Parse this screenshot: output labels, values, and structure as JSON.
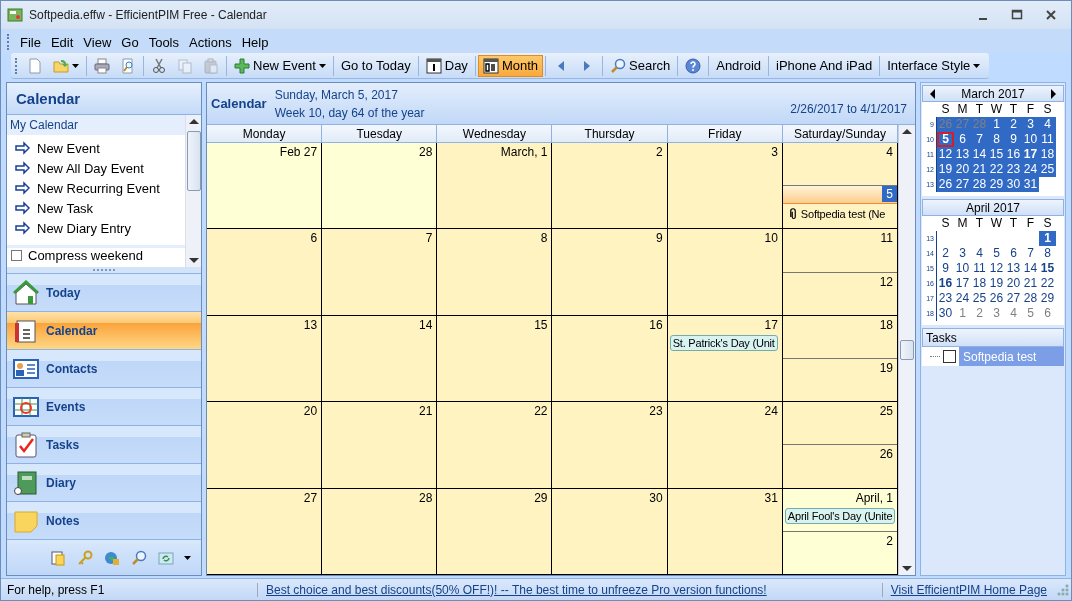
{
  "window": {
    "title": "Softpedia.effw - EfficientPIM Free - Calendar"
  },
  "menu": [
    "File",
    "Edit",
    "View",
    "Go",
    "Tools",
    "Actions",
    "Help"
  ],
  "toolbar": [
    {
      "kind": "icon",
      "disabled": false
    },
    {
      "kind": "icon",
      "disabled": false,
      "dropdown": true
    },
    {
      "kind": "separator"
    },
    {
      "kind": "icon",
      "disabled": false
    },
    {
      "kind": "icon",
      "disabled": false
    },
    {
      "kind": "separator"
    },
    {
      "kind": "icon",
      "disabled": false
    },
    {
      "kind": "icon",
      "disabled": true
    },
    {
      "kind": "icon",
      "disabled": true
    },
    {
      "kind": "separator"
    },
    {
      "kind": "button",
      "label": "New Event",
      "disabled": false,
      "dropdown": true
    },
    {
      "kind": "separator"
    },
    {
      "kind": "button",
      "label": "Go to Today",
      "disabled": false
    },
    {
      "kind": "separator"
    },
    {
      "kind": "button",
      "label": "Day",
      "disabled": false,
      "selected": false
    },
    {
      "kind": "separator"
    },
    {
      "kind": "button",
      "label": "Month",
      "disabled": false,
      "selected": true
    },
    {
      "kind": "separator"
    },
    {
      "kind": "icon",
      "disabled": false
    },
    {
      "kind": "icon",
      "disabled": false
    },
    {
      "kind": "separator"
    },
    {
      "kind": "button",
      "label": "Search",
      "disabled": false
    },
    {
      "kind": "separator"
    },
    {
      "kind": "icon",
      "disabled": false
    },
    {
      "kind": "separator"
    },
    {
      "kind": "button",
      "label": "Android",
      "disabled": false
    },
    {
      "kind": "separator"
    },
    {
      "kind": "button",
      "label": "iPhone And iPad",
      "disabled": false
    },
    {
      "kind": "separator"
    },
    {
      "kind": "button",
      "label": "Interface Style",
      "disabled": false,
      "dropdown": true
    }
  ],
  "sidebar": {
    "title": "Calendar",
    "section": "My Calendar",
    "actions": [
      "New Event",
      "New All Day Event",
      "New Recurring Event",
      "New Task",
      "New Diary Entry"
    ],
    "option": {
      "label": "Compress weekend",
      "checked": false
    },
    "nav": [
      {
        "label": "Today",
        "selected": false
      },
      {
        "label": "Calendar",
        "selected": true
      },
      {
        "label": "Contacts",
        "selected": false
      },
      {
        "label": "Events",
        "selected": false
      },
      {
        "label": "Tasks",
        "selected": false
      },
      {
        "label": "Diary",
        "selected": false
      },
      {
        "label": "Notes",
        "selected": false
      }
    ]
  },
  "calendar": {
    "title": "Calendar",
    "date": "Sunday, March 5, 2017",
    "week_info": "Week 10, day 64 of the year",
    "range": "2/26/2017 to 4/1/2017",
    "columns": [
      "Monday",
      "Tuesday",
      "Wednesday",
      "Thursday",
      "Friday",
      "Saturday/Sunday"
    ],
    "weeks": [
      [
        {
          "label": "Feb 27",
          "in_month": false,
          "selected": false
        },
        {
          "label": "28",
          "in_month": false,
          "selected": false
        },
        {
          "label": "March, 1",
          "in_month": true,
          "selected": false
        },
        {
          "label": "2",
          "in_month": true,
          "selected": false
        },
        {
          "label": "3",
          "in_month": true,
          "selected": false
        },
        {
          "label": "4",
          "in_month": true,
          "selected": false
        },
        {
          "label": "5",
          "in_month": true,
          "selected": true,
          "events": [
            {
              "kind": "attachment",
              "text": "Softpedia test (Ne"
            }
          ]
        }
      ],
      [
        {
          "label": "6",
          "in_month": true,
          "selected": false
        },
        {
          "label": "7",
          "in_month": true,
          "selected": false
        },
        {
          "label": "8",
          "in_month": true,
          "selected": false
        },
        {
          "label": "9",
          "in_month": true,
          "selected": false
        },
        {
          "label": "10",
          "in_month": true,
          "selected": false
        },
        {
          "label": "11",
          "in_month": true,
          "selected": false
        },
        {
          "label": "12",
          "in_month": true,
          "selected": false
        }
      ],
      [
        {
          "label": "13",
          "in_month": true,
          "selected": false
        },
        {
          "label": "14",
          "in_month": true,
          "selected": false
        },
        {
          "label": "15",
          "in_month": true,
          "selected": false
        },
        {
          "label": "16",
          "in_month": true,
          "selected": false
        },
        {
          "label": "17",
          "in_month": true,
          "selected": false,
          "events": [
            {
              "kind": "holiday",
              "text": "St. Patrick's Day (Unit"
            }
          ]
        },
        {
          "label": "18",
          "in_month": true,
          "selected": false
        },
        {
          "label": "19",
          "in_month": true,
          "selected": false
        }
      ],
      [
        {
          "label": "20",
          "in_month": true,
          "selected": false
        },
        {
          "label": "21",
          "in_month": true,
          "selected": false
        },
        {
          "label": "22",
          "in_month": true,
          "selected": false
        },
        {
          "label": "23",
          "in_month": true,
          "selected": false
        },
        {
          "label": "24",
          "in_month": true,
          "selected": false
        },
        {
          "label": "25",
          "in_month": true,
          "selected": false
        },
        {
          "label": "26",
          "in_month": true,
          "selected": false
        }
      ],
      [
        {
          "label": "27",
          "in_month": true,
          "selected": false
        },
        {
          "label": "28",
          "in_month": true,
          "selected": false
        },
        {
          "label": "29",
          "in_month": true,
          "selected": false
        },
        {
          "label": "30",
          "in_month": true,
          "selected": false
        },
        {
          "label": "31",
          "in_month": true,
          "selected": false
        },
        {
          "label": "April, 1",
          "in_month": false,
          "selected": false,
          "events": [
            {
              "kind": "holiday",
              "text": "April Fool's Day (Unite"
            }
          ]
        },
        {
          "label": "2",
          "in_month": false,
          "selected": false
        }
      ]
    ]
  },
  "mini_calendars": [
    {
      "title": "March 2017",
      "nav": true,
      "weekdays": [
        "S",
        "M",
        "T",
        "W",
        "T",
        "F",
        "S"
      ],
      "weeks": [
        {
          "week": "9",
          "days": [
            {
              "day": "26",
              "muted": true,
              "highlighted": true
            },
            {
              "day": "27",
              "muted": true,
              "highlighted": true
            },
            {
              "day": "28",
              "muted": true,
              "highlighted": true
            },
            {
              "day": "1",
              "highlighted": true
            },
            {
              "day": "2",
              "highlighted": true
            },
            {
              "day": "3",
              "highlighted": true
            },
            {
              "day": "4",
              "highlighted": true
            }
          ]
        },
        {
          "week": "10",
          "days": [
            {
              "day": "5",
              "highlighted": true,
              "bold": true,
              "today": true
            },
            {
              "day": "6",
              "highlighted": true
            },
            {
              "day": "7",
              "highlighted": true
            },
            {
              "day": "8",
              "highlighted": true
            },
            {
              "day": "9",
              "highlighted": true
            },
            {
              "day": "10",
              "highlighted": true
            },
            {
              "day": "11",
              "highlighted": true
            }
          ]
        },
        {
          "week": "11",
          "days": [
            {
              "day": "12",
              "highlighted": true
            },
            {
              "day": "13",
              "highlighted": true
            },
            {
              "day": "14",
              "highlighted": true
            },
            {
              "day": "15",
              "highlighted": true
            },
            {
              "day": "16",
              "highlighted": true
            },
            {
              "day": "17",
              "highlighted": true,
              "bold": true
            },
            {
              "day": "18",
              "highlighted": true
            }
          ]
        },
        {
          "week": "12",
          "days": [
            {
              "day": "19",
              "highlighted": true
            },
            {
              "day": "20",
              "highlighted": true
            },
            {
              "day": "21",
              "highlighted": true
            },
            {
              "day": "22",
              "highlighted": true
            },
            {
              "day": "23",
              "highlighted": true
            },
            {
              "day": "24",
              "highlighted": true
            },
            {
              "day": "25",
              "highlighted": true
            }
          ]
        },
        {
          "week": "13",
          "days": [
            {
              "day": "26",
              "highlighted": true
            },
            {
              "day": "27",
              "highlighted": true
            },
            {
              "day": "28",
              "highlighted": true
            },
            {
              "day": "29",
              "highlighted": true
            },
            {
              "day": "30",
              "highlighted": true
            },
            {
              "day": "31",
              "highlighted": true
            }
          ]
        }
      ]
    },
    {
      "title": "April 2017",
      "nav": false,
      "weekdays": [
        "S",
        "M",
        "T",
        "W",
        "T",
        "F",
        "S"
      ],
      "weeks": [
        {
          "week": "13",
          "kind": "endaligned",
          "days": [
            {
              "day": "1",
              "highlighted": true,
              "bold": true
            }
          ]
        },
        {
          "week": "14",
          "days": [
            {
              "day": "2"
            },
            {
              "day": "3"
            },
            {
              "day": "4"
            },
            {
              "day": "5"
            },
            {
              "day": "6"
            },
            {
              "day": "7"
            },
            {
              "day": "8"
            }
          ]
        },
        {
          "week": "15",
          "days": [
            {
              "day": "9"
            },
            {
              "day": "10"
            },
            {
              "day": "11"
            },
            {
              "day": "12"
            },
            {
              "day": "13"
            },
            {
              "day": "14"
            },
            {
              "day": "15",
              "bold": true
            }
          ]
        },
        {
          "week": "16",
          "days": [
            {
              "day": "16",
              "bold": true
            },
            {
              "day": "17"
            },
            {
              "day": "18"
            },
            {
              "day": "19"
            },
            {
              "day": "20"
            },
            {
              "day": "21"
            },
            {
              "day": "22"
            }
          ]
        },
        {
          "week": "17",
          "days": [
            {
              "day": "23"
            },
            {
              "day": "24"
            },
            {
              "day": "25"
            },
            {
              "day": "26"
            },
            {
              "day": "27"
            },
            {
              "day": "28"
            },
            {
              "day": "29"
            }
          ]
        },
        {
          "week": "18",
          "days": [
            {
              "day": "30"
            },
            {
              "day": "1",
              "muted": true
            },
            {
              "day": "2",
              "muted": true
            },
            {
              "day": "3",
              "muted": true
            },
            {
              "day": "4",
              "muted": true
            },
            {
              "day": "5",
              "muted": true
            },
            {
              "day": "6",
              "muted": true
            }
          ]
        }
      ]
    }
  ],
  "tasks": {
    "title": "Tasks",
    "items": [
      {
        "label": "Softpedia test",
        "checked": false,
        "selected": true
      }
    ]
  },
  "status_bar": {
    "help": "For help, press F1",
    "promo_link": "Best choice and best discounts(50% OFF!)! -- The best time to unfreeze Pro version functions!",
    "home_link": "Visit EfficientPIM Home Page"
  }
}
